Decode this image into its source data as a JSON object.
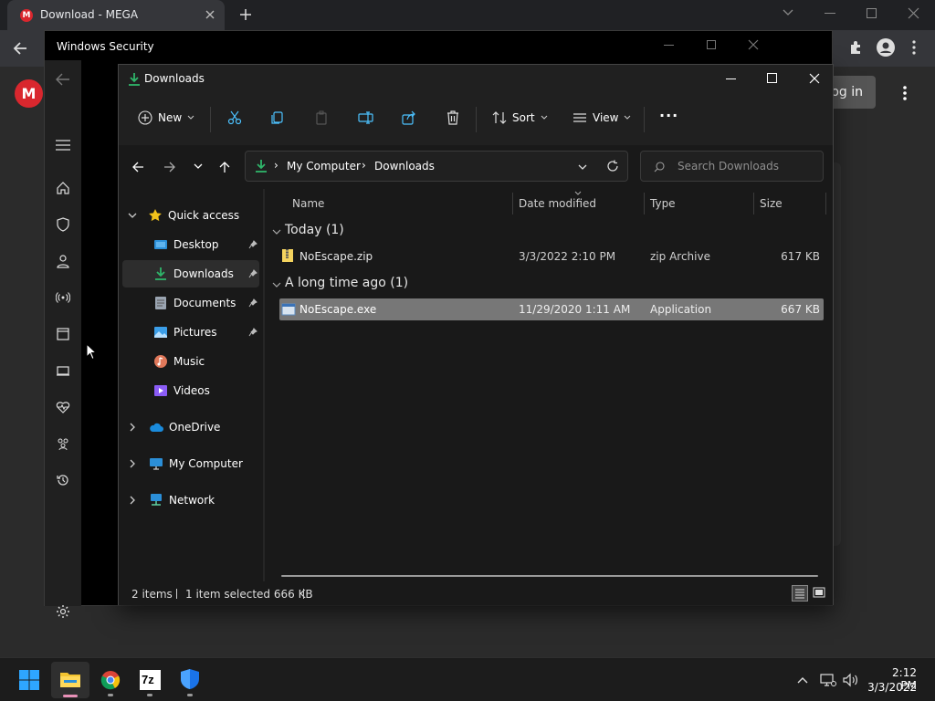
{
  "browser": {
    "tab_title": "Download - MEGA",
    "login_button": "Log in",
    "colors": {
      "mega_red": "#d9272e"
    }
  },
  "security_window": {
    "title": "Windows Security",
    "sidebar_icons": [
      "back-arrow-icon",
      "hamburger-icon",
      "home-icon",
      "shield-icon",
      "person-icon",
      "wireless-icon",
      "app-browser-icon",
      "laptop-icon",
      "heart-pulse-icon",
      "family-icon",
      "history-icon",
      "gear-icon"
    ]
  },
  "explorer": {
    "title": "Downloads",
    "toolbar": {
      "new_label": "New",
      "sort_label": "Sort",
      "view_label": "View",
      "more_label": "···"
    },
    "address": {
      "crumbs": [
        "My Computer",
        "Downloads"
      ],
      "separator": "›",
      "search_placeholder": "Search Downloads"
    },
    "nav": {
      "quick_access": "Quick access",
      "items": [
        {
          "label": "Desktop",
          "icon": "desktop-icon"
        },
        {
          "label": "Downloads",
          "icon": "download-icon"
        },
        {
          "label": "Documents",
          "icon": "documents-icon"
        },
        {
          "label": "Pictures",
          "icon": "pictures-icon"
        },
        {
          "label": "Music",
          "icon": "music-icon"
        },
        {
          "label": "Videos",
          "icon": "videos-icon"
        }
      ],
      "onedrive": "OneDrive",
      "my_computer": "My Computer",
      "network": "Network"
    },
    "columns": {
      "name": "Name",
      "date": "Date modified",
      "type": "Type",
      "size": "Size"
    },
    "groups": [
      {
        "label": "Today (1)",
        "files": [
          {
            "name": "NoEscape.zip",
            "date": "3/3/2022 2:10 PM",
            "type": "zip Archive",
            "size": "617 KB"
          }
        ]
      },
      {
        "label": "A long time ago (1)",
        "files": [
          {
            "name": "NoEscape.exe",
            "date": "11/29/2020 1:11 AM",
            "type": "Application",
            "size": "667 KB"
          }
        ]
      }
    ],
    "status": {
      "items": "2 items",
      "selected": "1 item selected  666 KB"
    }
  },
  "taskbar": {
    "time": "2:12 PM",
    "date": "3/3/2022",
    "sevenzip_label": "7z"
  }
}
